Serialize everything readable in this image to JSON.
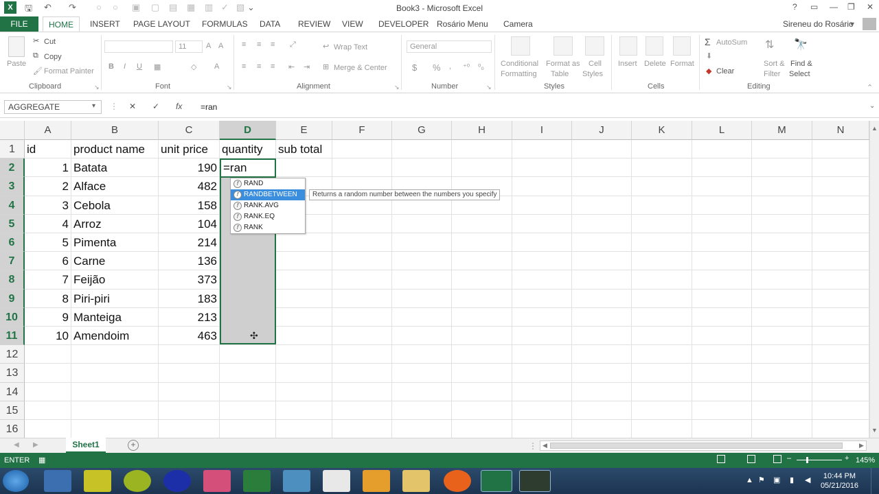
{
  "titlebar": {
    "title": "Book3 - Microsoft Excel",
    "help": "?",
    "minimize": "—",
    "restore": "❐",
    "close": "✕"
  },
  "tabs": {
    "file": "FILE",
    "items": [
      "HOME",
      "INSERT",
      "PAGE LAYOUT",
      "FORMULAS",
      "DATA",
      "REVIEW",
      "VIEW",
      "DEVELOPER",
      "Rosário Menu",
      "Camera"
    ],
    "user": "Sireneu do Rosário"
  },
  "ribbon": {
    "clipboard": {
      "paste": "Paste",
      "cut": "Cut",
      "copy": "Copy",
      "format_painter": "Format Painter",
      "label": "Clipboard"
    },
    "font": {
      "size": "11",
      "label": "Font",
      "bold": "B",
      "italic": "I",
      "underline": "U"
    },
    "alignment": {
      "wrap": "Wrap Text",
      "merge": "Merge & Center",
      "label": "Alignment"
    },
    "number": {
      "format": "General",
      "currency": "$",
      "percent": "%",
      "label": "Number"
    },
    "styles": {
      "conditional": "Conditional",
      "formatting": "Formatting",
      "format_as": "Format as",
      "table": "Table",
      "cell": "Cell",
      "styles": "Styles",
      "label": "Styles"
    },
    "cells": {
      "insert": "Insert",
      "delete": "Delete",
      "format": "Format",
      "label": "Cells"
    },
    "editing": {
      "autosum": "AutoSum",
      "clear": "Clear",
      "sort": "Sort &",
      "filter": "Filter",
      "find": "Find &",
      "select": "Select",
      "label": "Editing"
    }
  },
  "formula_bar": {
    "name_box": "AGGREGATE",
    "cancel": "✕",
    "enter": "✓",
    "fx": "fx",
    "content": "=ran"
  },
  "grid": {
    "columns": [
      "A",
      "B",
      "C",
      "D",
      "E",
      "F",
      "G",
      "H",
      "I",
      "J",
      "K",
      "L",
      "M",
      "N"
    ],
    "rows": [
      "1",
      "2",
      "3",
      "4",
      "5",
      "6",
      "7",
      "8",
      "9",
      "10",
      "11",
      "12",
      "13",
      "14",
      "15",
      "16"
    ],
    "headers": {
      "a": "id",
      "b": "product name",
      "c": "unit price",
      "d": "quantity",
      "e": "sub total"
    },
    "data": [
      {
        "id": "1",
        "name": "Batata",
        "price": "190"
      },
      {
        "id": "2",
        "name": "Alface",
        "price": "482"
      },
      {
        "id": "3",
        "name": "Cebola",
        "price": "158"
      },
      {
        "id": "4",
        "name": "Arroz",
        "price": "104"
      },
      {
        "id": "5",
        "name": "Pimenta",
        "price": "214"
      },
      {
        "id": "6",
        "name": "Carne",
        "price": "136"
      },
      {
        "id": "7",
        "name": "Feijão",
        "price": "373"
      },
      {
        "id": "8",
        "name": "Piri-piri",
        "price": "183"
      },
      {
        "id": "9",
        "name": "Manteiga",
        "price": "213"
      },
      {
        "id": "10",
        "name": "Amendoim",
        "price": "463"
      }
    ],
    "active_cell_text": "=ran"
  },
  "autocomplete": {
    "items": [
      "RAND",
      "RANDBETWEEN",
      "RANK.AVG",
      "RANK.EQ",
      "RANK"
    ],
    "tooltip": "Returns a random number between the numbers you specify"
  },
  "sheets": {
    "tabs": [
      "Sheet1"
    ],
    "add": "+"
  },
  "statusbar": {
    "mode": "ENTER",
    "zoom": "145%"
  },
  "taskbar": {
    "time": "10:44 PM",
    "date": "05/21/2016"
  }
}
